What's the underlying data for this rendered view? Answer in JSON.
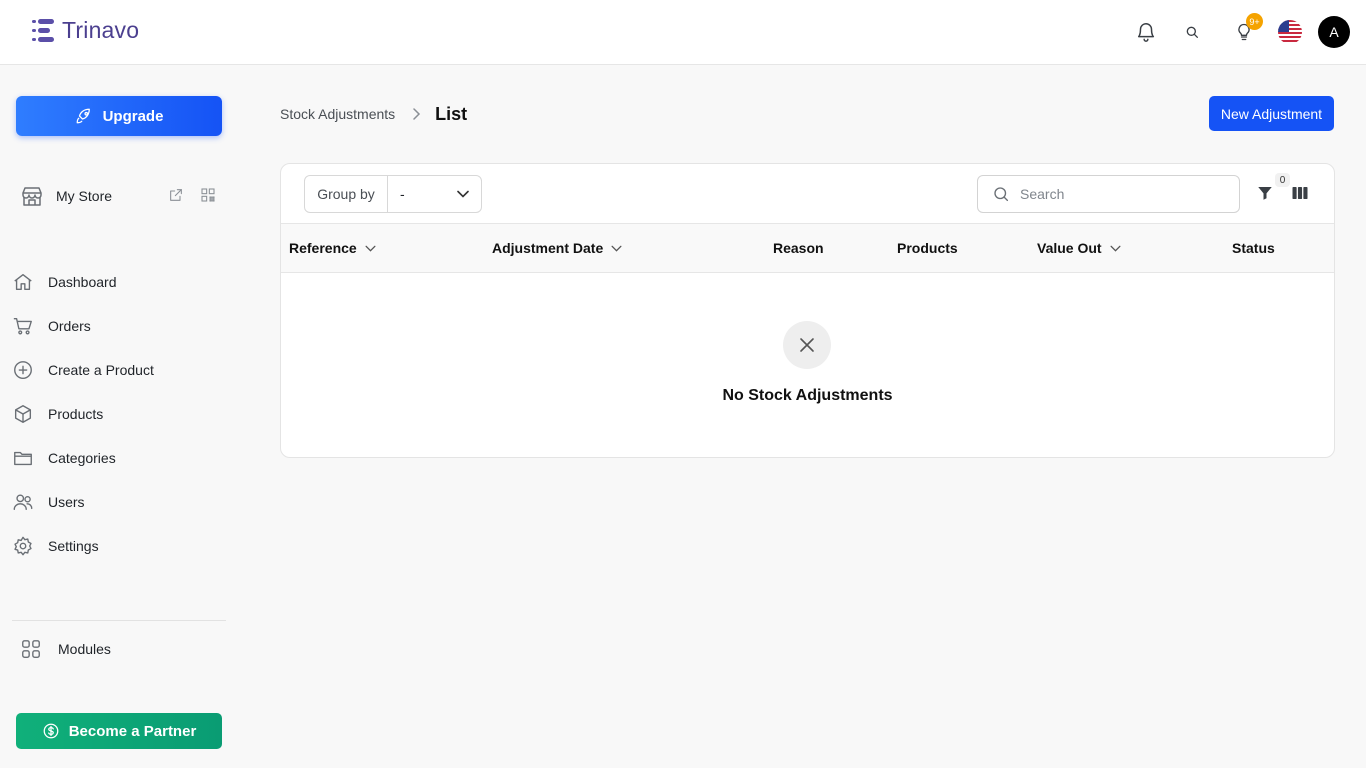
{
  "app": {
    "name": "Trinavo"
  },
  "header": {
    "notifications_badge": "9+",
    "avatar_initial": "A",
    "language_flag": "us-flag-icon"
  },
  "sidebar": {
    "upgrade_label": "Upgrade",
    "store_label": "My Store",
    "items": [
      {
        "label": "Dashboard",
        "icon": "home-icon"
      },
      {
        "label": "Orders",
        "icon": "cart-icon"
      },
      {
        "label": "Create a Product",
        "icon": "plus-circle-icon"
      },
      {
        "label": "Products",
        "icon": "box-icon"
      },
      {
        "label": "Categories",
        "icon": "folder-icon"
      },
      {
        "label": "Users",
        "icon": "users-icon"
      },
      {
        "label": "Settings",
        "icon": "gear-icon"
      }
    ],
    "modules_label": "Modules",
    "partner_label": "Become a Partner"
  },
  "breadcrumb": {
    "parent": "Stock Adjustments",
    "current": "List"
  },
  "actions": {
    "new_label": "New Adjustment"
  },
  "toolbar": {
    "group_by_label": "Group by",
    "group_by_value": "-",
    "search_placeholder": "Search",
    "filter_count": "0"
  },
  "table": {
    "columns": [
      "Reference",
      "Adjustment Date",
      "Reason",
      "Products",
      "Value Out",
      "Status"
    ],
    "empty_message": "No Stock Adjustments"
  },
  "colors": {
    "primary": "#1553f5",
    "partner": "#0a9c73",
    "logo": "#4b3f8f",
    "badge": "#f5a300"
  }
}
